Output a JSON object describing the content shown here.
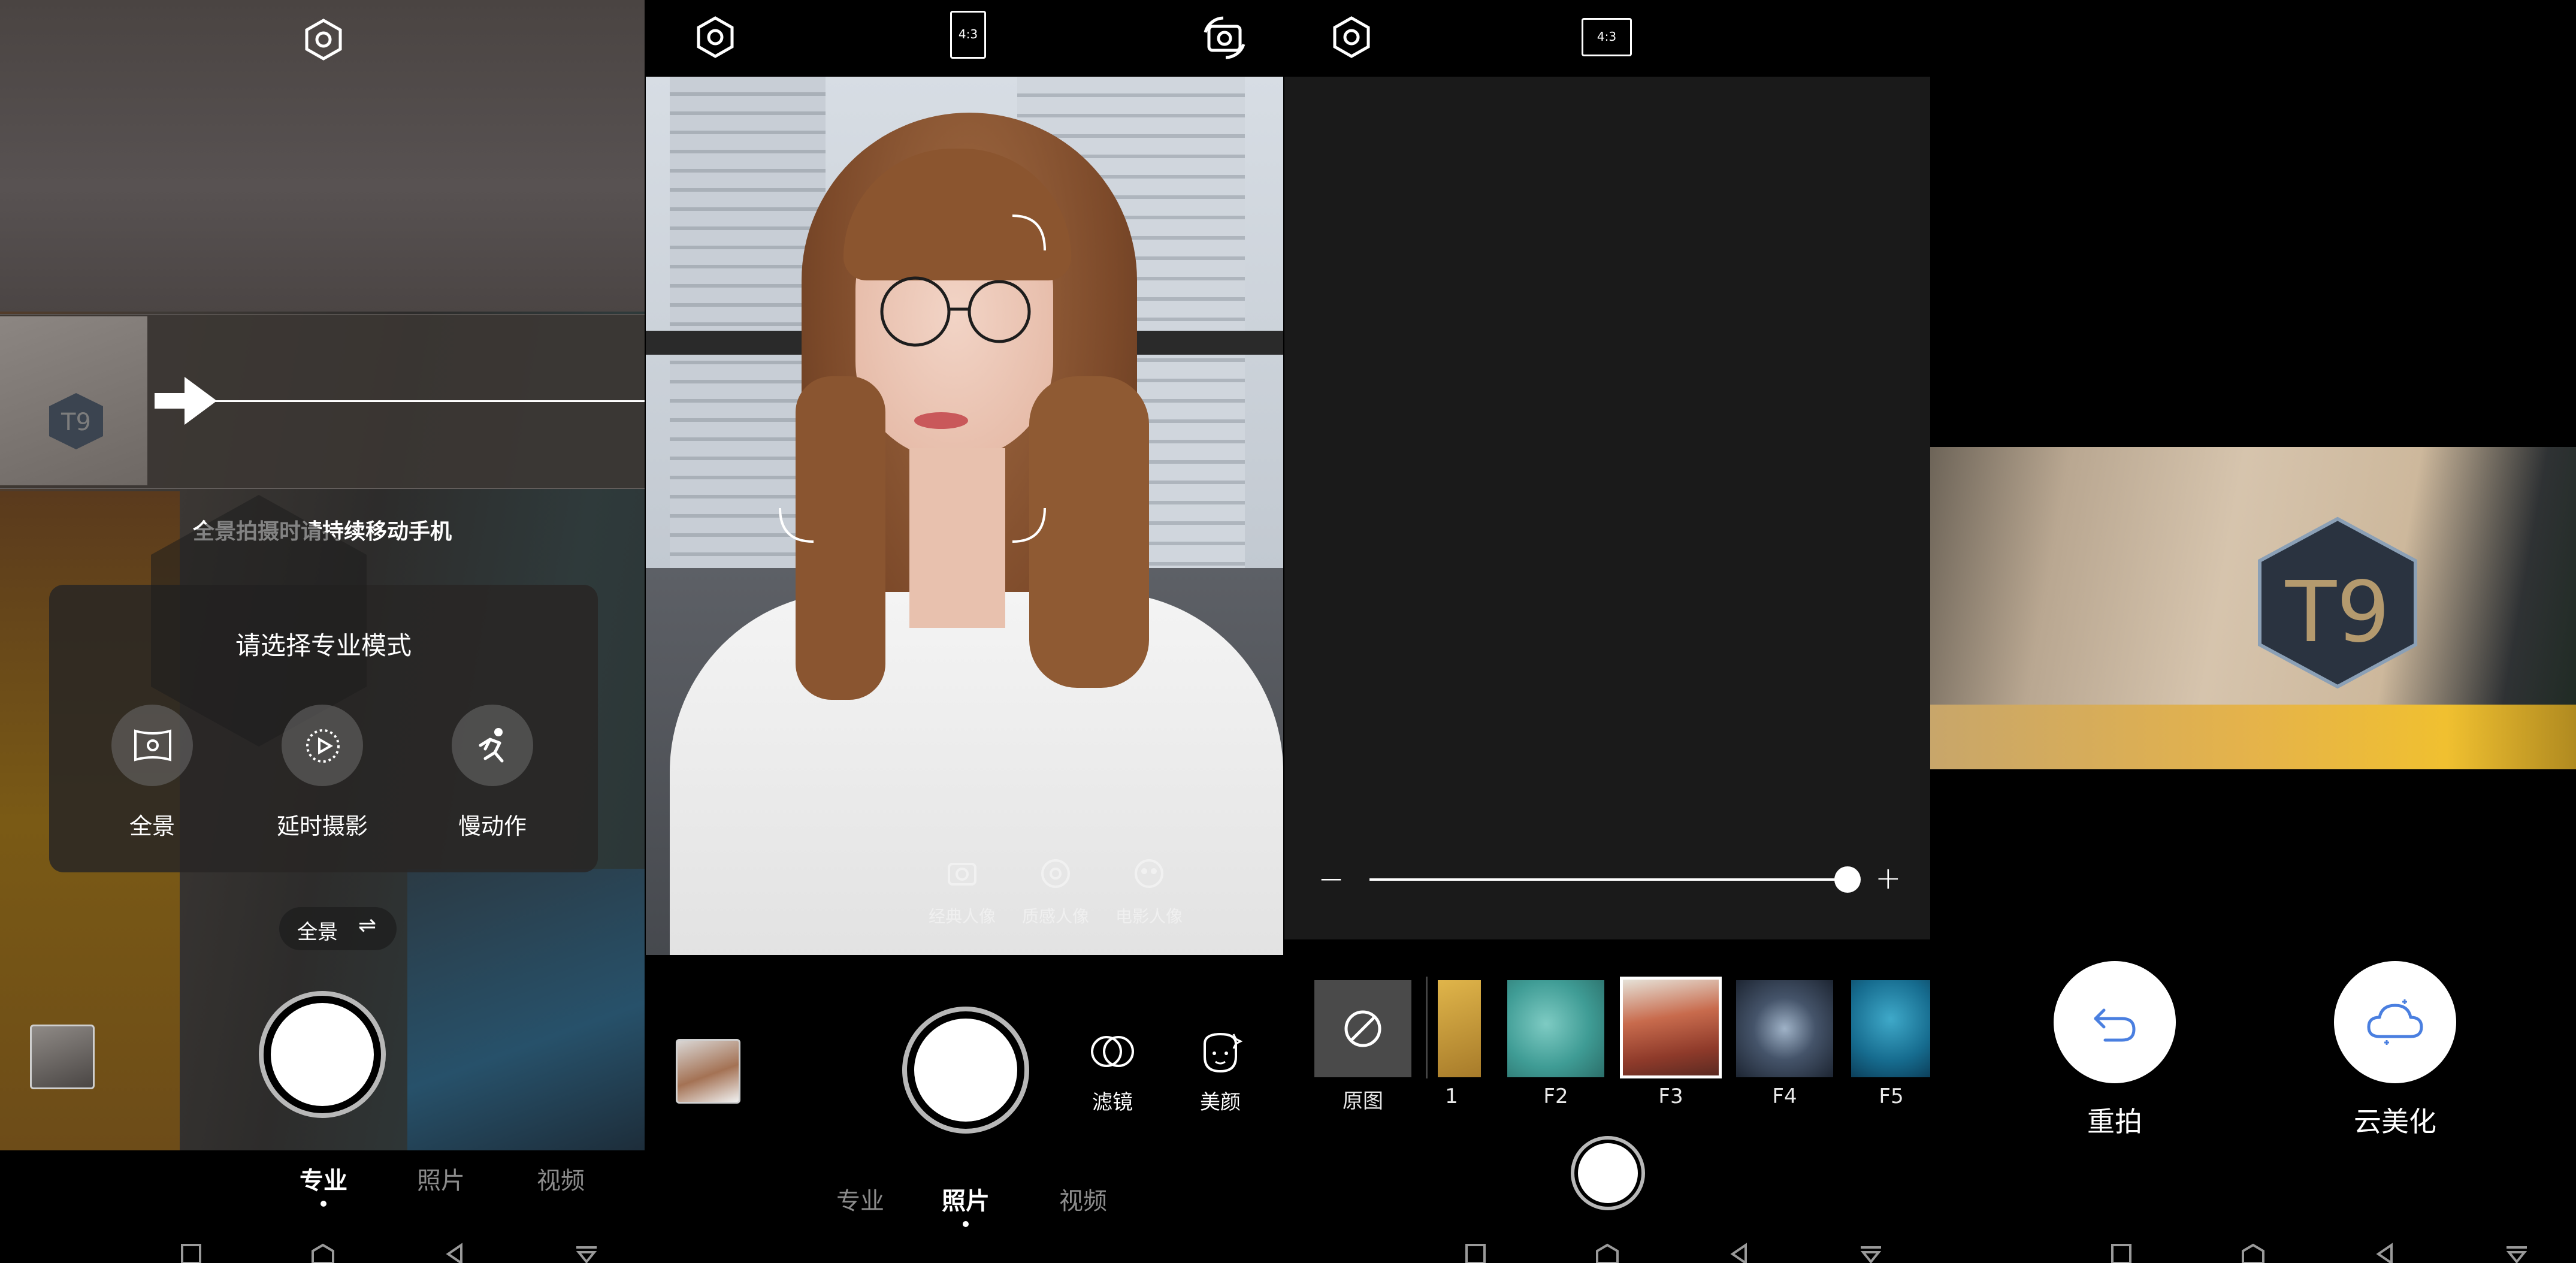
{
  "screen1": {
    "panorama_hint": "全景拍摄时请持续移动手机",
    "popup_title": "请选择专业模式",
    "modes": [
      {
        "label": "全景",
        "icon": "panorama-icon"
      },
      {
        "label": "延时摄影",
        "icon": "timelapse-icon"
      },
      {
        "label": "慢动作",
        "icon": "slow-motion-icon"
      }
    ],
    "panorama_switch_label": "全景",
    "switch_symbol": "⇌",
    "tabs": [
      {
        "label": "专业",
        "active": true
      },
      {
        "label": "照片",
        "active": false
      },
      {
        "label": "视频",
        "active": false
      }
    ]
  },
  "screen2": {
    "aspect_ratio": "4:3",
    "portrait_modes": [
      "经典人像",
      "质感人像",
      "电影人像"
    ],
    "filter_label": "滤镜",
    "beauty_label": "美颜",
    "tabs": [
      {
        "label": "专业",
        "active": false
      },
      {
        "label": "照片",
        "active": true
      },
      {
        "label": "视频",
        "active": false
      }
    ]
  },
  "screen3": {
    "aspect_ratio": "4:3",
    "slider_minus": "—",
    "slider_plus": "+",
    "slider_level": 1.0,
    "filters": [
      {
        "label": "原图",
        "selected": false
      },
      {
        "label": "1",
        "selected": false
      },
      {
        "label": "F2",
        "selected": false
      },
      {
        "label": "F3",
        "selected": true
      },
      {
        "label": "F4",
        "selected": false
      },
      {
        "label": "F5",
        "selected": false
      }
    ]
  },
  "screen4": {
    "box_text": "T9",
    "retake_label": "重拍",
    "cloud_beautify_label": "云美化"
  },
  "colors": {
    "background": "#000000",
    "accent_blue": "#4a7fe0",
    "inactive_tab": "#8c8c8c"
  }
}
